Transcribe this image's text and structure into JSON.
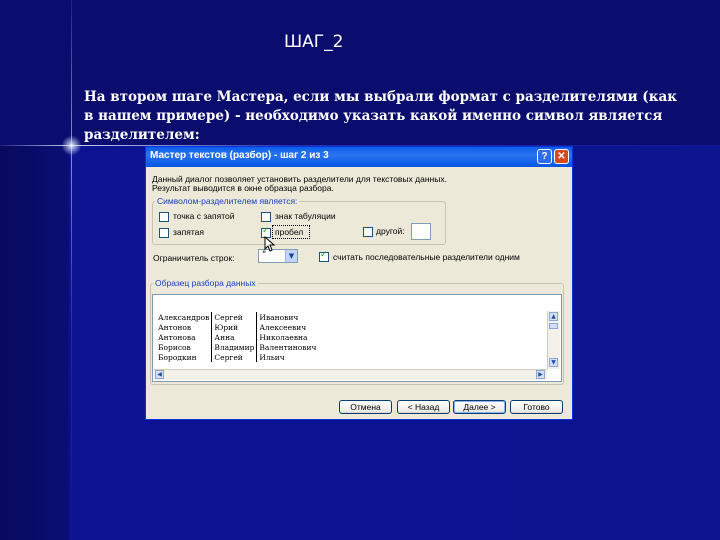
{
  "slide": {
    "title": "ШАГ_2",
    "text": "На втором шаге Мастера, если мы выбрали формат с разделителями (как в нашем примере) - необходимо указать какой именно символ является разделителем:"
  },
  "dialog": {
    "title": "Мастер текстов (разбор) - шаг 2 из 3",
    "help_label": "?",
    "close_label": "✕",
    "description_line1": "Данный диалог позволяет установить разделители для текстовых данных.",
    "description_line2": "Результат выводится в окне образца разбора.",
    "delimiters_group_label": "Символом-разделителем является:",
    "delimiters": {
      "tab": {
        "label": "знак табуляции",
        "checked": false
      },
      "semicolon": {
        "label": "точка с запятой",
        "checked": false
      },
      "comma": {
        "label": "запятая",
        "checked": false
      },
      "space": {
        "label": "пробел",
        "checked": true
      },
      "other": {
        "label": "другой:",
        "checked": false,
        "value": ""
      }
    },
    "text_qualifier_label": "Ограничитель строк:",
    "text_qualifier_value": "\"",
    "consecutive_label": "считать последовательные разделители одним",
    "consecutive_checked": true,
    "preview_group_label": "Образец разбора данных",
    "preview_rows": [
      [
        "Александров",
        "Сергей",
        "Иванович"
      ],
      [
        "Антонов",
        "Юрий",
        "Алексеевич"
      ],
      [
        "Антонова",
        "Анна",
        "Николаевна"
      ],
      [
        "Борисов",
        "Владимир",
        "Валентинович"
      ],
      [
        "Бородкин",
        "Сергей",
        "Ильич"
      ]
    ],
    "buttons": {
      "cancel": "Отмена",
      "back": "< Назад",
      "next": "Далее >",
      "finish": "Готово"
    }
  },
  "colors": {
    "slide_background": "#0b0f7a",
    "titlebar": "#0054e3",
    "dialog_face": "#ece9d8"
  }
}
